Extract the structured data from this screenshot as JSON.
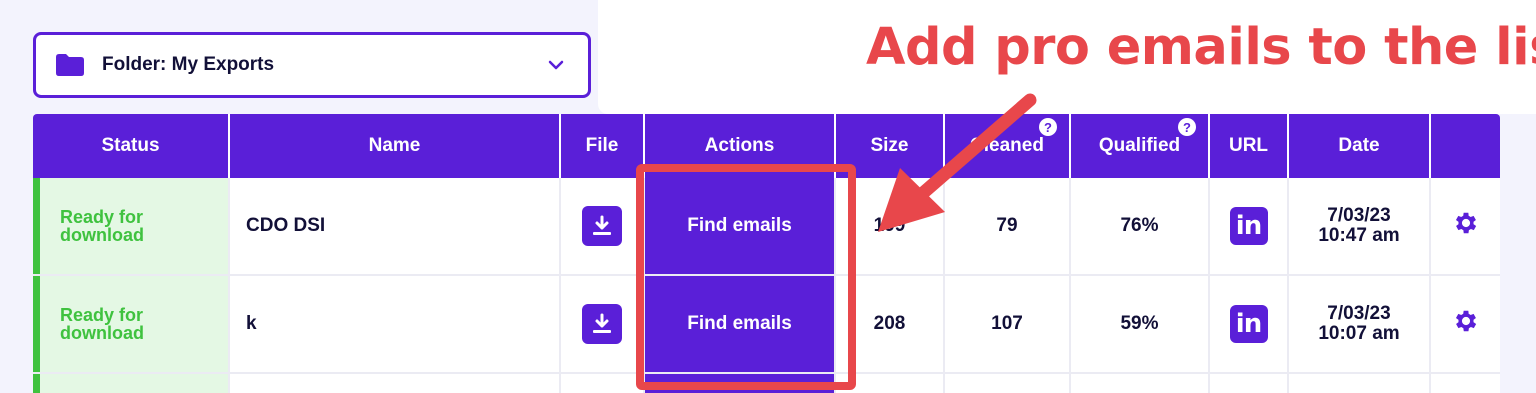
{
  "annotation": {
    "title": "Add pro emails to the list",
    "color": "#e8474b"
  },
  "folder": {
    "label": "Folder: My Exports",
    "icon": "folder-icon",
    "chevron": "chevron-down-icon"
  },
  "table": {
    "headers": [
      "Status",
      "Name",
      "File",
      "Actions",
      "Size",
      "Cleaned",
      "Qualified",
      "URL",
      "Date",
      ""
    ],
    "help_icon": "?",
    "rows": [
      {
        "status": "Ready for download",
        "name": "CDO DSI",
        "action": "Find emails",
        "size": "199",
        "cleaned": "79",
        "qualified": "76%",
        "url_icon": "in",
        "date_line1": "7/03/23",
        "date_line2": "10:47 am"
      },
      {
        "status": "Ready for download",
        "name": "k",
        "action": "Find emails",
        "size": "208",
        "cleaned": "107",
        "qualified": "59%",
        "url_icon": "in",
        "date_line1": "7/03/23",
        "date_line2": "10:07 am"
      }
    ]
  },
  "colors": {
    "accent": "#5a1fd8",
    "ready": "#3fc23f",
    "ready_bg": "#e4f8e4",
    "text": "#121038"
  }
}
